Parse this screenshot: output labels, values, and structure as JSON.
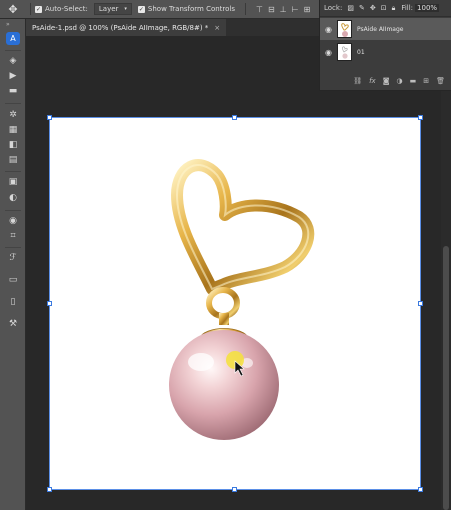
{
  "options_bar": {
    "move_tool_icon": "move-icon",
    "auto_select_label": "Auto-Select:",
    "auto_select_checked": true,
    "layer_target": "Layer",
    "show_transform_label": "Show Transform Controls",
    "show_transform_checked": true
  },
  "document_tab": {
    "title": "PsAide-1.psd @ 100% (PsAide AIImage, RGB/8#) *",
    "close": "×"
  },
  "layers_panel": {
    "lock_label": "Lock:",
    "fill_label": "Fill:",
    "fill_value": "100%",
    "layers": [
      {
        "name": "PsAide AIImage",
        "visible": true,
        "selected": true
      },
      {
        "name": "01",
        "visible": true,
        "selected": false
      }
    ],
    "footer_icons": [
      "link-icon",
      "fx-icon",
      "mask-icon",
      "adjustment-icon",
      "folder-icon",
      "new-layer-icon",
      "delete-icon"
    ]
  },
  "toolbar": {
    "tools": [
      "ai-assistant-icon",
      "quick-select-icon",
      "pen-arrow-icon",
      "comment-icon",
      "stamp-icon",
      "grid-icon",
      "gradient-icon",
      "frame-icon",
      "image-icon",
      "shape-icon",
      "blur-icon",
      "path-select-icon",
      "type-icon",
      "note-icon",
      "edit-toolbar-icon"
    ]
  },
  "colors": {
    "accent": "#2a6fd6",
    "selection_frame": "#5b8fe6",
    "app_bg": "#282828",
    "panel_bg": "#3c3c3c"
  }
}
